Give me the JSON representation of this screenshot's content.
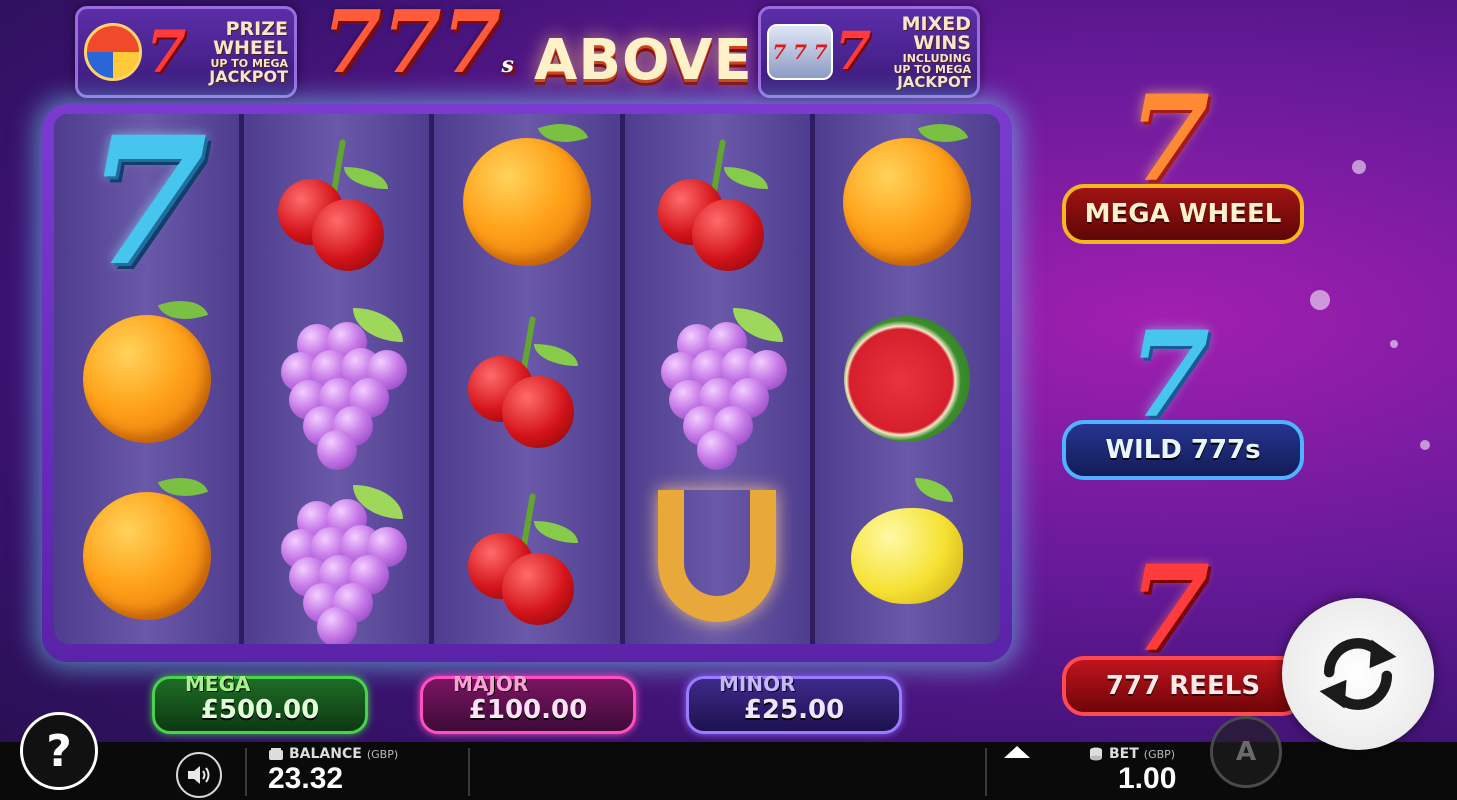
{
  "banners": {
    "left": {
      "line1": "PRIZE",
      "line2": "WHEEL",
      "line3": "UP TO MEGA",
      "line4": "JACKPOT"
    },
    "right": {
      "line1": "MIXED",
      "line2": "WINS",
      "line3": "INCLUDING",
      "line4": "UP TO MEGA",
      "line5": "JACKPOT"
    }
  },
  "logo": {
    "sevens": "777",
    "suffix": "s",
    "word": "ABOVE"
  },
  "reels": [
    [
      "seven-blue",
      "orange",
      "orange"
    ],
    [
      "cherries",
      "grapes",
      "grapes"
    ],
    [
      "orange",
      "cherries",
      "cherries"
    ],
    [
      "cherries",
      "grapes",
      "horseshoe"
    ],
    [
      "orange",
      "watermelon",
      "lemon"
    ]
  ],
  "symbols": {
    "seven_glyph": "7"
  },
  "jackpots": {
    "mega": {
      "label": "MEGA",
      "value": "£500.00",
      "color": "#49d24e"
    },
    "major": {
      "label": "MAJOR",
      "value": "£100.00",
      "color": "#ff4fc0"
    },
    "minor": {
      "label": "MINOR",
      "value": "£25.00",
      "color": "#9a7aff"
    }
  },
  "features": {
    "mega_wheel": {
      "seven": "7",
      "label": "MEGA WHEEL"
    },
    "wild": {
      "seven": "7",
      "label": "WILD 777s"
    },
    "reels": {
      "seven": "7",
      "label": "777 REELS"
    }
  },
  "controls": {
    "help": "?",
    "autoplay": "A",
    "balance_label": "BALANCE",
    "balance_currency": "(GBP)",
    "balance_value": "23.32",
    "bet_label": "BET",
    "bet_currency": "(GBP)",
    "bet_value": "1.00"
  },
  "icons": {
    "help": "help-icon",
    "sound": "speaker-icon",
    "wallet": "wallet-icon",
    "coins": "coins-icon",
    "spin": "spin-arrows-icon",
    "bet_up": "triangle-up-icon",
    "autoplay": "autoplay-icon"
  }
}
